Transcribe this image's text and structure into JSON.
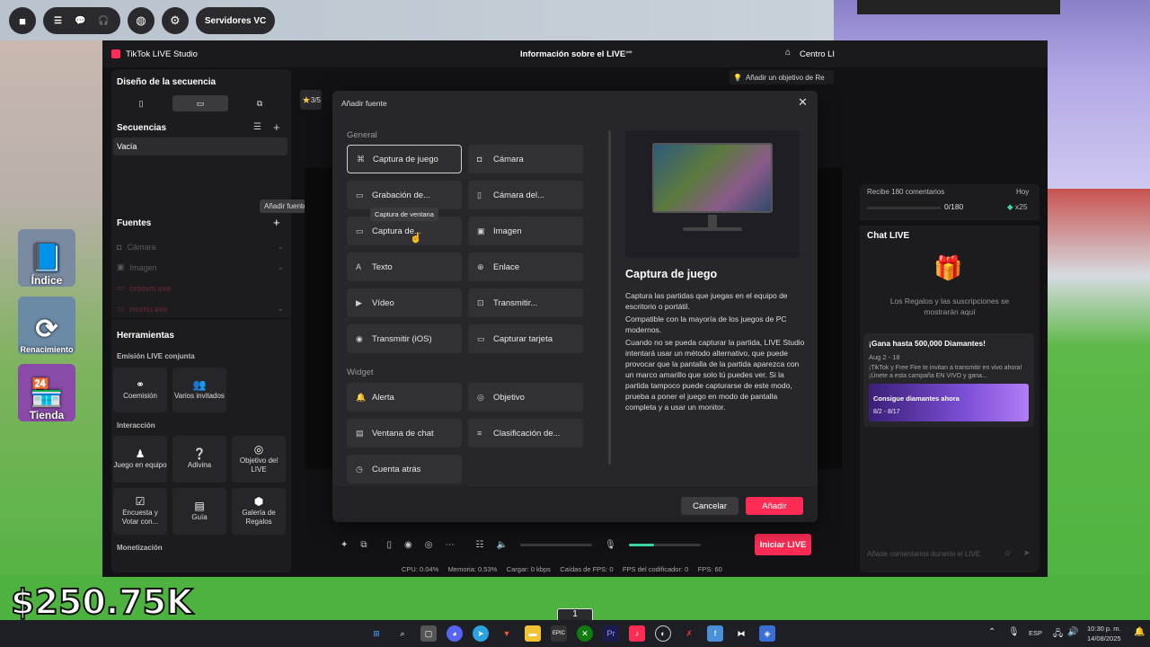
{
  "game": {
    "server_pill": "Servidores VC",
    "side": [
      "Índice",
      "Renacimiento",
      "Tienda"
    ],
    "money": "$250.75K",
    "hotbar": "1"
  },
  "studio": {
    "app_title": "TikTok LIVE Studio",
    "center_title": "Información sobre el LIVE",
    "center_right": "Centro LI",
    "goal_hint": "Añadir un objetivo de Re",
    "scene_badge": "3/5"
  },
  "left": {
    "design_title": "Diseño de la secuencia",
    "sequences_title": "Secuencias",
    "empty_seq": "Vacía",
    "sources_title": "Fuentes",
    "add_source_tooltip": "Añadir fuente",
    "sources": [
      "Cámara",
      "Imagen",
      "crosvm.exe",
      "mumu.exe"
    ],
    "tools_title": "Herramientas",
    "joint_title": "Emisión LIVE conjunta",
    "joint_tools": [
      "Coemisión",
      "Varios invitados"
    ],
    "interaction_title": "Interacción",
    "interaction_tools": [
      "Juego en equipo",
      "Adivina",
      "Objetivo del LIVE",
      "Encuesta y Votar con...",
      "Guía",
      "Galería de Regalos"
    ],
    "monetization_title": "Monetización"
  },
  "dialog": {
    "title": "Añadir fuente",
    "general_label": "General",
    "widget_label": "Widget",
    "general_sources": [
      {
        "label": "Captura de juego",
        "icon": "gamepad-icon"
      },
      {
        "label": "Cámara",
        "icon": "camera-icon"
      },
      {
        "label": "Grabación de...",
        "icon": "monitor-icon"
      },
      {
        "label": "Cámara del...",
        "icon": "phone-camera-icon"
      },
      {
        "label": "Captura de...",
        "icon": "window-icon"
      },
      {
        "label": "Imagen",
        "icon": "image-icon"
      },
      {
        "label": "Texto",
        "icon": "text-icon"
      },
      {
        "label": "Enlace",
        "icon": "globe-icon"
      },
      {
        "label": "Vídeo",
        "icon": "play-icon"
      },
      {
        "label": "Transmitir...",
        "icon": "cast-icon"
      },
      {
        "label": "Transmitir (iOS)",
        "icon": "ios-icon"
      },
      {
        "label": "Capturar tarjeta",
        "icon": "card-icon"
      }
    ],
    "widget_sources": [
      {
        "label": "Alerta",
        "icon": "bell-icon"
      },
      {
        "label": "Objetivo",
        "icon": "target-icon"
      },
      {
        "label": "Ventana de chat",
        "icon": "chat-icon"
      },
      {
        "label": "Clasificación de...",
        "icon": "ranking-icon"
      },
      {
        "label": "Cuenta atrás",
        "icon": "timer-icon"
      }
    ],
    "hover_tooltip": "Captura de ventana",
    "preview_title": "Captura de juego",
    "preview_p1": "Captura las partidas que juegas en el equipo de escritorio o portátil.",
    "preview_p2": "Compatible con la mayoría de los juegos de PC modernos.",
    "preview_p3": "Cuando no se pueda capturar la partida, LIVE Studio intentará usar un método alternativo, que puede provocar que la pantalla de la partida aparezca con un marco amarillo que solo tú puedes ver. Si la partida tampoco puede capturarse de este modo, prueba a poner el juego en modo de pantalla completa y a usar un monitor.",
    "cancel": "Cancelar",
    "add": "Añadir"
  },
  "bottom": {
    "start_live": "Iniciar LIVE",
    "stats": "CPU: 0.04%     Memoria: 0.53%     Cargar: 0 kbps     Caídas de FPS: 0     FPS del codificador: 0     FPS: 60",
    "mic_level": 0.35
  },
  "right": {
    "goal_text": "Recibe 180 comentarios",
    "goal_period": "Hoy",
    "goal_progress": "0/180",
    "goal_reward": "x25",
    "chat_title": "Chat LIVE",
    "chat_empty": "Los Regalos y las suscripciones se mostrarán aquí",
    "promo_title": "¡Gana hasta 500,000 Diamantes!",
    "promo_date": "Aug 2 - 18",
    "promo_desc": "¡TikTok y Free Fire te invitan a transmitir en vivo ahora! ¡Únete a esta campaña EN VIVO y gana...",
    "promo_banner": "Consigue diamantes ahora",
    "promo_banner_date": "8/2 - 8/17",
    "comment_placeholder": "Añade comentarios durante el LIVE"
  },
  "taskbar": {
    "lang": "ESP",
    "time": "10:30 p. m.",
    "date": "14/08/2025"
  },
  "colors": {
    "accent": "#fe2c55"
  }
}
